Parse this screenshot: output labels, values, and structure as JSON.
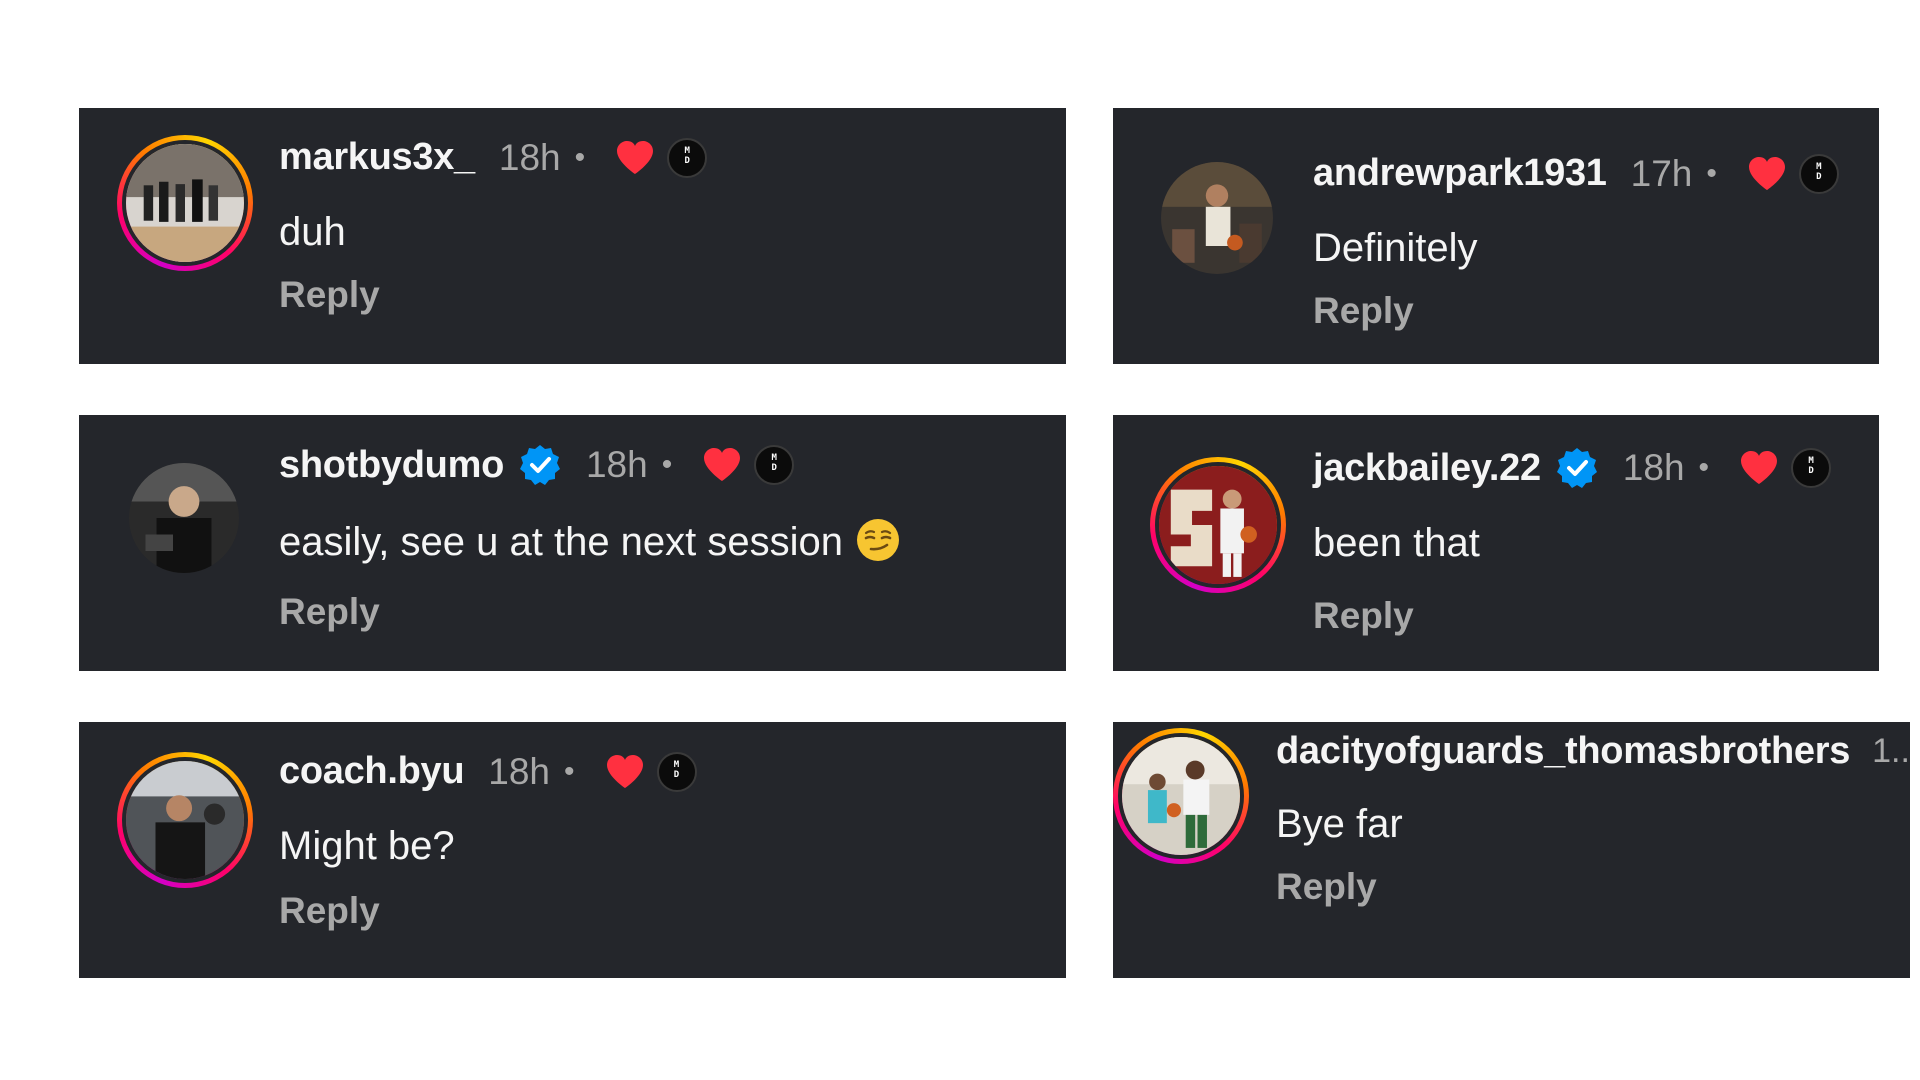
{
  "comments": [
    {
      "username": "markus3x_",
      "verified": false,
      "time": "18h",
      "separator": "•",
      "text": "duh",
      "reply_label": "Reply",
      "liked": true,
      "badge_text": "MA\nDE",
      "story_ring": true
    },
    {
      "username": "andrewpark1931",
      "verified": false,
      "time": "17h",
      "separator": "•",
      "text": "Definitely",
      "reply_label": "Reply",
      "liked": true,
      "badge_text": "MA\nDE",
      "story_ring": false
    },
    {
      "username": "shotbydumo",
      "verified": true,
      "time": "18h",
      "separator": "•",
      "text": "easily,  see u at the next session",
      "emoji": "smirking-face",
      "reply_label": "Reply",
      "liked": true,
      "badge_text": "MA\nDE",
      "story_ring": false
    },
    {
      "username": "jackbailey.22",
      "verified": true,
      "time": "18h",
      "separator": "•",
      "text": "been that",
      "reply_label": "Reply",
      "liked": true,
      "badge_text": "MA\nDE",
      "story_ring": true
    },
    {
      "username": "coach.byu",
      "verified": false,
      "time": "18h",
      "separator": "•",
      "text": "Might be?",
      "reply_label": "Reply",
      "liked": true,
      "badge_text": "MA\nDE",
      "story_ring": true
    },
    {
      "username": "dacityofguards_thomasbrothers",
      "verified": false,
      "time_truncated": "1..",
      "text": "Bye far",
      "reply_label": "Reply",
      "story_ring": true
    }
  ],
  "colors": {
    "card_bg": "#24262b",
    "page_bg": "#ffffff",
    "heart": "#ff3040",
    "verified": "#0095f6",
    "muted_text": "#a8a8a8",
    "primary_text": "#f5f5f5"
  },
  "icons": {
    "like": "heart-icon",
    "verified": "verified-badge-icon",
    "badge": "made-badge-icon"
  }
}
